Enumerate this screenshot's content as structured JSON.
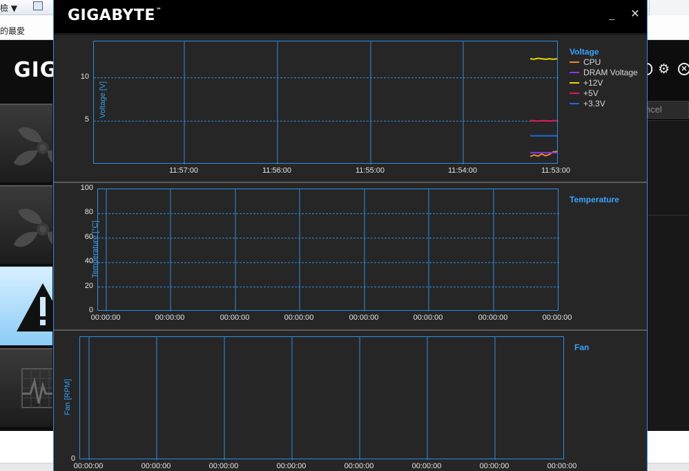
{
  "background": {
    "toolbar_left": "檢",
    "toolbar_right": "▼",
    "toolbar_extra": "▼",
    "address_text": "的最愛",
    "logo_text": "GIG",
    "cancel_label": "ncel"
  },
  "window": {
    "brand": "GIGABYTE",
    "brand_tm": "™",
    "minimize_label": "_",
    "close_label": "✕"
  },
  "voltage": {
    "legend_title": "Voltage",
    "ylabel": "Voltage [V]",
    "chart_data": {
      "type": "line",
      "title": "Voltage",
      "ylabel": "Voltage [V]",
      "xlabel": "",
      "x_ticks": [
        "11:57:00",
        "11:56:00",
        "11:55:00",
        "11:54:00",
        "11:53:00"
      ],
      "y_ticks": [
        5,
        10
      ],
      "series": [
        {
          "name": "CPU",
          "color": "#f08a24",
          "values": [
            0.9,
            1.1,
            0.95,
            1.2,
            1.0,
            1.15,
            1.45,
            1.5
          ]
        },
        {
          "name": "DRAM Voltage",
          "color": "#8a37e6",
          "values": [
            1.35,
            1.35,
            1.35,
            1.35,
            1.35,
            1.35,
            1.35,
            1.35
          ]
        },
        {
          "name": "+12V",
          "color": "#e8d800",
          "values": [
            12.2,
            12.15,
            12.25,
            12.2,
            12.15,
            12.2,
            12.15,
            12.2
          ]
        },
        {
          "name": "+5V",
          "color": "#e01a5a",
          "values": [
            5.05,
            5.05,
            5.0,
            5.05,
            5.05,
            5.0,
            5.05,
            5.05
          ]
        },
        {
          "name": "+3.3V",
          "color": "#1e6ae0",
          "values": [
            3.3,
            3.3,
            3.3,
            3.3,
            3.3,
            3.3,
            3.3,
            3.3
          ]
        }
      ]
    }
  },
  "temperature": {
    "legend_title": "Temperature",
    "ylabel": "Temperature [°C]",
    "chart_data": {
      "type": "line",
      "title": "Temperature",
      "ylabel": "Temperature [°C]",
      "xlabel": "",
      "ylim": [
        0,
        100
      ],
      "y_ticks": [
        0,
        20,
        40,
        60,
        80,
        100
      ],
      "x_ticks": [
        "00:00:00",
        "00:00:00",
        "00:00:00",
        "00:00:00",
        "00:00:00",
        "00:00:00",
        "00:00:00",
        "00:00:00"
      ],
      "series": []
    }
  },
  "fan": {
    "legend_title": "Fan",
    "ylabel": "Fan [RPM]",
    "chart_data": {
      "type": "line",
      "title": "Fan",
      "ylabel": "Fan [RPM]",
      "xlabel": "",
      "y_ticks": [
        0
      ],
      "x_ticks": [
        "00:00:00",
        "00:00:00",
        "00:00:00",
        "00:00:00",
        "00:00:00",
        "00:00:00",
        "00:00:00",
        "00:00:00"
      ],
      "series": []
    }
  }
}
